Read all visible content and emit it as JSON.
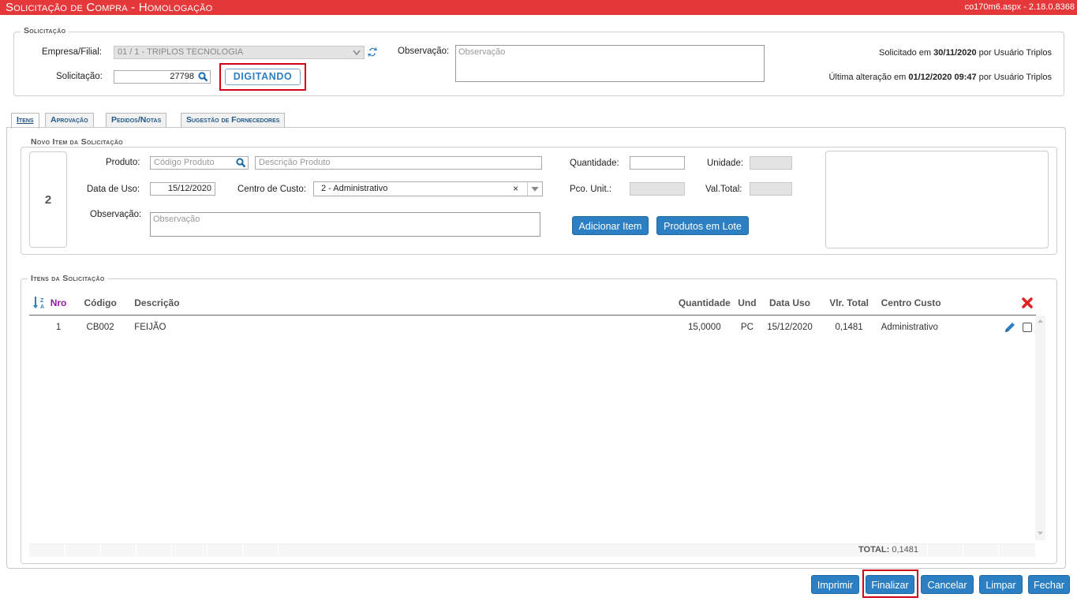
{
  "title": {
    "left": "Solicitação de Compra  - Homologação",
    "right": "co170m6.aspx - 2.18.0.8368"
  },
  "solicitacao": {
    "legend": "Solicitação",
    "empresa_label": "Empresa/Filial:",
    "empresa_value": "01 / 1 - TRIPLOS TECNOLOGIA",
    "solicitacao_label": "Solicitação:",
    "solicitacao_value": "27798",
    "status": "DIGITANDO",
    "observacao_label": "Observação:",
    "observacao_placeholder": "Observação",
    "solicitado_prefix": "Solicitado em",
    "solicitado_date": "30/11/2020",
    "solicitado_suffix": "por Usuário Triplos",
    "alteracao_prefix": "Última alteração em",
    "alteracao_date": "01/12/2020 09:47",
    "alteracao_suffix": "por Usuário Triplos"
  },
  "tabs": [
    {
      "label": "Itens"
    },
    {
      "label": "Aprovação"
    },
    {
      "label": "Pedidos/Notas"
    },
    {
      "label": "Sugestão de Fornecedores"
    }
  ],
  "novo_item": {
    "legend": "Novo Item da Solicitação",
    "number": "2",
    "produto_label": "Produto:",
    "codigo_placeholder": "Código Produto",
    "descricao_placeholder": "Descrição Produto",
    "data_uso_label": "Data de Uso:",
    "data_uso_value": "15/12/2020",
    "centro_custo_label": "Centro de Custo:",
    "centro_custo_value": "2 - Administrativo",
    "observacao_label": "Observação:",
    "observacao_placeholder": "Observação",
    "quantidade_label": "Quantidade:",
    "unidade_label": "Unidade:",
    "pco_unit_label": "Pco. Unit.:",
    "val_total_label": "Val.Total:",
    "adicionar_button": "Adicionar Item",
    "lote_button": "Produtos em Lote"
  },
  "itens": {
    "legend": "Itens da Solicitação",
    "columns": [
      "Nro",
      "Código",
      "Descrição",
      "Quantidade",
      "Und",
      "Data Uso",
      "Vlr. Total",
      "Centro Custo"
    ],
    "rows": [
      {
        "nro": "1",
        "codigo": "CB002",
        "descricao": "FEIJÃO",
        "quantidade": "15,0000",
        "und": "PC",
        "data_uso": "15/12/2020",
        "vlr_total": "0,1481",
        "centro_custo": "Administrativo"
      }
    ],
    "total_label": "TOTAL:",
    "total_value": "0,1481"
  },
  "footer": {
    "imprimir": "Imprimir",
    "finalizar": "Finalizar",
    "cancelar": "Cancelar",
    "limpar": "Limpar",
    "fechar": "Fechar"
  },
  "colors": {
    "titlebar": "#e5383b",
    "button": "#2b7fc2",
    "highlight": "#d0021b",
    "nro_header": "#8b1ea5"
  }
}
